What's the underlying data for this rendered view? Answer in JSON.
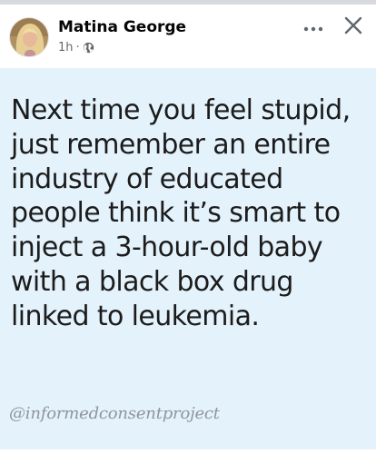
{
  "post": {
    "author_name": "Matina George",
    "timestamp": "1h",
    "separator": "·",
    "privacy_icon": "globe-icon",
    "more_icon": "more-dots-icon",
    "close_icon": "close-icon",
    "text": "Next time you feel stupid,\njust remember an entire\nindustry of educated\npeople think it’s smart to\ninject a 3-hour-old baby\nwith a black box drug\nlinked to leukemia.",
    "watermark": "@informedconsentproject",
    "background_color": "#e4f2fb"
  }
}
